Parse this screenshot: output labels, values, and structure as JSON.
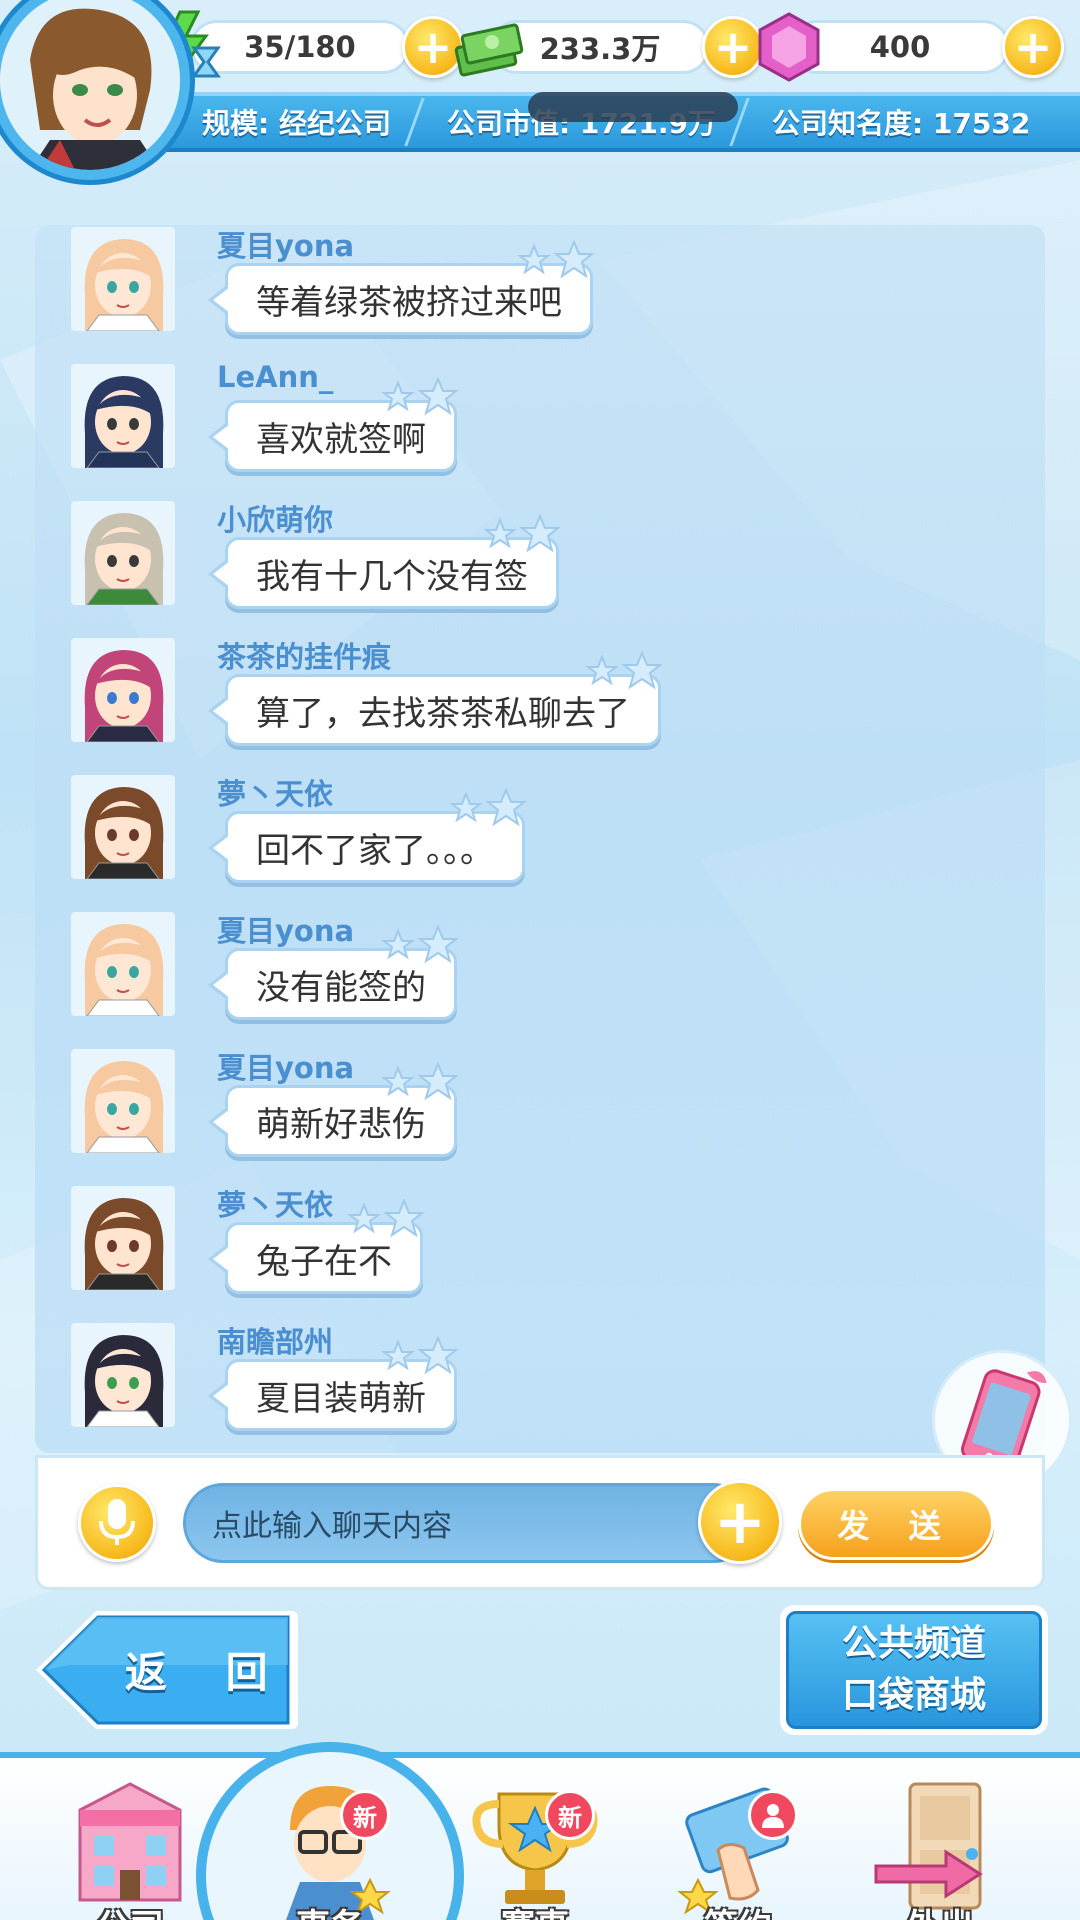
{
  "resources": [
    {
      "icon": "energy-hourglass-icon",
      "value": "35/180"
    },
    {
      "icon": "cash-stack-icon",
      "value": "233.3万"
    },
    {
      "icon": "pink-gem-icon",
      "value": "400"
    }
  ],
  "company": {
    "scale": "规模: 经纪公司",
    "market_value": "公司市值: 1721.9万",
    "fame": "公司知名度: 17532"
  },
  "messages": [
    {
      "name": "夏目yona",
      "text": "等着绿茶被挤过来吧",
      "avatar": "blonde-girl"
    },
    {
      "name": "LeAnn_",
      "text": "喜欢就签啊",
      "avatar": "captain-boy"
    },
    {
      "name": "小欣萌你",
      "text": "我有十几个没有签",
      "avatar": "glasses-boy"
    },
    {
      "name": "茶茶的挂件痕",
      "text": "算了，去找茶茶私聊去了",
      "avatar": "red-hair-boy"
    },
    {
      "name": "夢丶天依",
      "text": "回不了家了。。。",
      "avatar": "brown-hair-boy"
    },
    {
      "name": "夏目yona",
      "text": "没有能签的",
      "avatar": "blonde-girl"
    },
    {
      "name": "夏目yona",
      "text": "萌新好悲伤",
      "avatar": "blonde-girl"
    },
    {
      "name": "夢丶天依",
      "text": "兔子在不",
      "avatar": "brown-hair-boy"
    },
    {
      "name": "南瞻部州",
      "text": "夏目装萌新",
      "avatar": "dark-hair-girl"
    }
  ],
  "input": {
    "placeholder": "点此输入聊天内容",
    "send_label": "发 送"
  },
  "buttons": {
    "back": "返 回",
    "channel_line1": "公共频道",
    "channel_line2": "口袋商城"
  },
  "nav": [
    {
      "label": "公司",
      "badge": ""
    },
    {
      "label": "事务",
      "badge": "新"
    },
    {
      "label": "赛事",
      "badge": "新"
    },
    {
      "label": "签约",
      "badge": "person"
    },
    {
      "label": "外出",
      "badge": ""
    }
  ],
  "colors": {
    "accent": "#2a98dc",
    "name": "#4a8fd0",
    "gold": "#f7b81c",
    "badge": "#f0485e"
  }
}
